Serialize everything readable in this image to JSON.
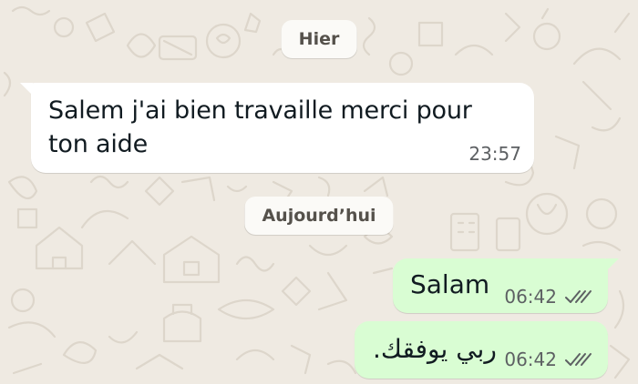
{
  "colors": {
    "wallpaper": "#efeae2",
    "incoming_bubble": "#ffffff",
    "outgoing_bubble": "#d9fdd3",
    "date_pill": "#fbfaf7",
    "read_ticks": "#5d6063"
  },
  "date_separators": {
    "yesterday": "Hier",
    "today": "Aujourd’hui"
  },
  "messages": [
    {
      "direction": "incoming",
      "text": "Salem j'ai bien travaille merci pour ton aide",
      "time": "23:57"
    },
    {
      "direction": "outgoing",
      "text": "Salam",
      "time": "06:42",
      "status_icon": "double-check-icon"
    },
    {
      "direction": "outgoing",
      "text": "ربي يوفقك.",
      "time": "06:42",
      "status_icon": "double-check-icon"
    }
  ]
}
